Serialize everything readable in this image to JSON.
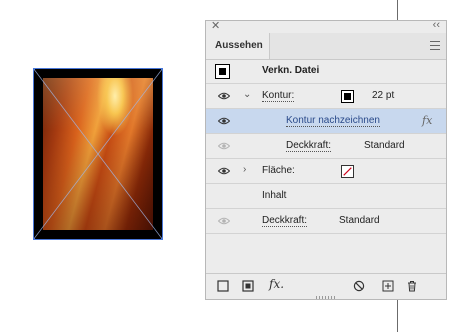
{
  "panel": {
    "tab_label": "Aussehen",
    "rows": {
      "object_label": "Verkn. Datei",
      "stroke_label": "Kontur:",
      "stroke_weight": "22 pt",
      "draw_stroke_label": "Kontur nachzeichnen",
      "stroke_opacity_label": "Deckkraft:",
      "stroke_opacity_value": "Standard",
      "fill_label": "Fläche:",
      "content_label": "Inhalt",
      "opacity_label": "Deckkraft:",
      "opacity_value": "Standard"
    },
    "colors": {
      "selected_row": "#c8d8ee",
      "stroke_swatch": "#000000",
      "fill_none_slash": "#d0021b"
    }
  }
}
